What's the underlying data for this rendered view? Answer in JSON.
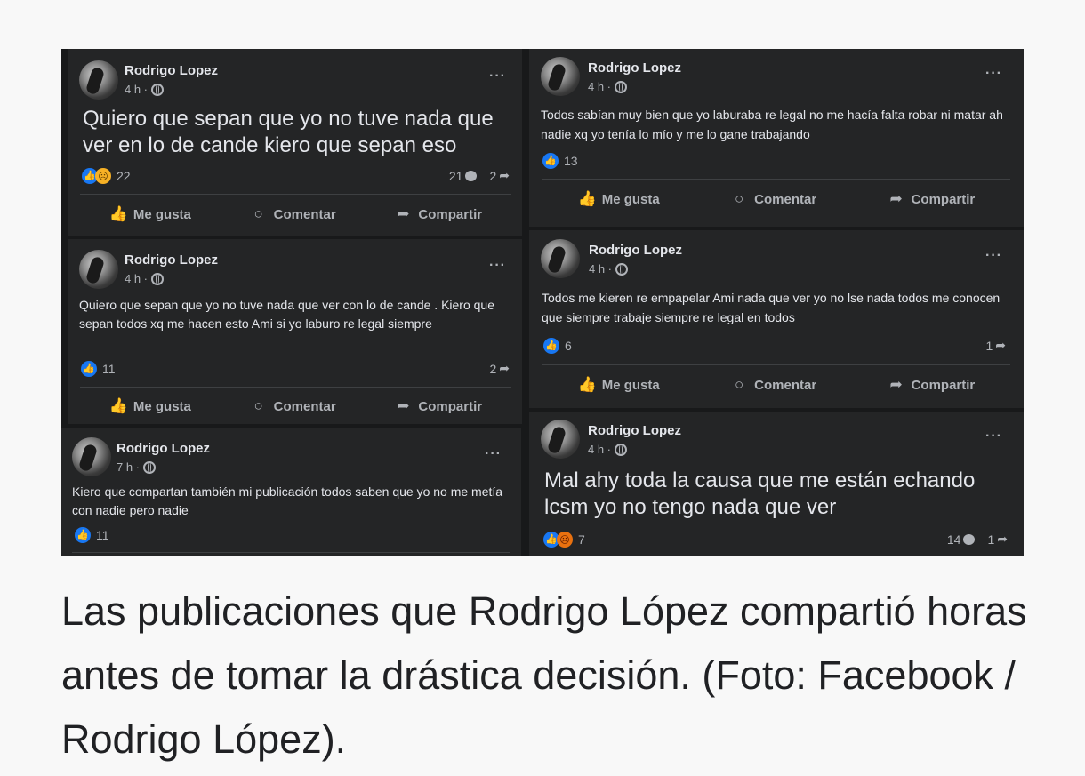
{
  "posts": [
    {
      "author": "Rodrigo Lopez",
      "time": "4 h ·",
      "more": "···",
      "text": "Quiero que sepan que yo no tuve nada que ver en lo de cande kiero que sepan eso",
      "reactions_count": "22",
      "comments_count": "21",
      "shares_count": "2"
    },
    {
      "author": "Rodrigo Lopez",
      "time": "4 h ·",
      "more": "···",
      "text": "Todos sabían muy bien que yo laburaba re legal no me hacía falta robar ni matar ah nadie xq yo tenía lo mío y me lo gane trabajando",
      "reactions_count": "13"
    },
    {
      "author": "Rodrigo Lopez",
      "time": "4 h ·",
      "more": "···",
      "text": "Quiero que sepan que yo no tuve nada que ver con lo de cande . Kiero que sepan todos xq me hacen esto Ami si yo laburo re legal siempre",
      "reactions_count": "11",
      "shares_count": "2"
    },
    {
      "author": "Rodrigo Lopez",
      "time": "4 h ·",
      "more": "···",
      "text": "Todos me kieren re empapelar Ami nada que ver yo no lse nada todos me conocen que siempre trabaje siempre re legal en todos",
      "reactions_count": "6",
      "shares_count": "1"
    },
    {
      "author": "Rodrigo Lopez",
      "time": "7 h ·",
      "more": "···",
      "text": "Kiero que compartan también mi publicación todos saben que yo no me metía con nadie pero nadie",
      "reactions_count": "11"
    },
    {
      "author": "Rodrigo Lopez",
      "time": "4 h ·",
      "more": "···",
      "text": "Mal ahy toda la causa que me están echando lcsm yo no tengo nada que ver",
      "reactions_count": "7",
      "comments_count": "14",
      "shares_count": "1"
    }
  ],
  "actions": {
    "like": "Me gusta",
    "comment": "Comentar",
    "share": "Compartir"
  },
  "icons": {
    "like": "thumbs-up-icon",
    "comment": "comment-icon",
    "share": "share-icon",
    "privacy": "globe-icon",
    "more": "more-options-icon"
  },
  "colors": {
    "facebook_blue": "#1877f2",
    "card_bg": "#242526",
    "page_bg": "#f8f8f8"
  },
  "caption": "Las publicaciones que Rodrigo López compartió horas antes de tomar la drástica decisión. (Foto: Facebook / Rodrigo López)."
}
